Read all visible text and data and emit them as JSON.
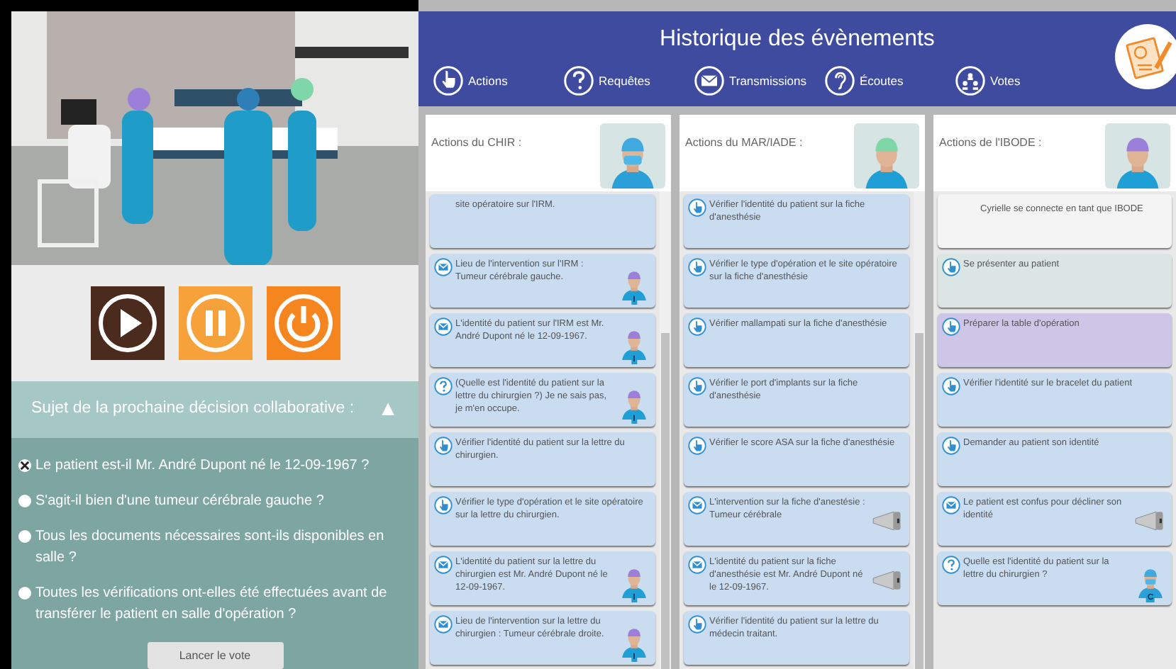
{
  "controls": [
    {
      "kind": "play"
    },
    {
      "kind": "pause"
    },
    {
      "kind": "power"
    }
  ],
  "decision": {
    "title": "Sujet de la prochaine décision collaborative :",
    "toggle": "▲",
    "questions": [
      {
        "text": "Le patient est-il Mr. André Dupont né le 12-09-1967 ?",
        "checked": true
      },
      {
        "text": "S'agit-il bien d'une tumeur cérébrale gauche ?",
        "checked": false
      },
      {
        "text": "Tous les documents nécessaires sont-ils disponibles en salle ?",
        "checked": false
      },
      {
        "text": "Toutes les vérifications ont-elles été effectuées avant de transférer le patient en salle d'opération ?",
        "checked": false
      }
    ],
    "button": "Lancer le vote"
  },
  "header": {
    "title": "Historique des évènements",
    "nav": [
      {
        "label": "Actions",
        "kind": "hand"
      },
      {
        "label": "Requêtes",
        "kind": "question"
      },
      {
        "label": "Transmissions",
        "kind": "mail"
      },
      {
        "label": "Écoutes",
        "kind": "ear"
      },
      {
        "label": "Votes",
        "kind": "people"
      }
    ]
  },
  "columns": [
    {
      "title": "Actions du CHIR :",
      "avatar": {
        "kind": "surgeon"
      },
      "scrollbar": true,
      "cards": [
        {
          "kind": "plain",
          "text": "site opératoire sur l'IRM.",
          "color": "#c9dcf0"
        },
        {
          "kind": "message",
          "text": "Lieu de l'intervention sur l'IRM : Tumeur cérébrale gauche.",
          "color": "#c9dcf0",
          "avatar": {
            "kind": "nurse",
            "badge": "I"
          }
        },
        {
          "kind": "message",
          "text": "L'identité du patient sur l'IRM est Mr. André Dupont né le 12-09-1967.",
          "color": "#c9dcf0",
          "avatar": {
            "kind": "nurse",
            "badge": "I"
          }
        },
        {
          "kind": "question",
          "text": "(Quelle est l'identité du patient sur la lettre du chirurgien ?) Je ne sais pas, je m'en occupe.",
          "color": "#c9dcf0",
          "avatar": {
            "kind": "nurse",
            "badge": "I"
          }
        },
        {
          "kind": "action",
          "text": "Vérifier l'identité du patient sur la lettre du chirurgien.",
          "color": "#c9dcf0"
        },
        {
          "kind": "action",
          "text": "Vérifier le type d'opération et le site opératoire sur la lettre du chirurgien.",
          "color": "#c9dcf0"
        },
        {
          "kind": "message",
          "text": "L'identité du patient sur la lettre du chirurgien est Mr. André Dupont né le 12-09-1967.",
          "color": "#c9dcf0",
          "avatar": {
            "kind": "nurse",
            "badge": "I"
          }
        },
        {
          "kind": "message",
          "text": "Lieu de l'intervention sur la lettre du chirurgien : Tumeur cérébrale droite.",
          "color": "#c9dcf0",
          "avatar": {
            "kind": "nurse",
            "badge": "I"
          }
        }
      ]
    },
    {
      "title": "Actions du MAR/IADE :",
      "avatar": {
        "kind": "anesthetist"
      },
      "scrollbar": true,
      "cards": [
        {
          "kind": "action",
          "text": "Vérifier l'identité du patient sur la fiche d'anesthésie",
          "color": "#c9dcf0"
        },
        {
          "kind": "action",
          "text": "Vérifier le type d'opération et le site opératoire sur la fiche d'anesthésie",
          "color": "#c9dcf0"
        },
        {
          "kind": "action",
          "text": "Vérifier mallampati sur la fiche d'anesthésie",
          "color": "#c9dcf0"
        },
        {
          "kind": "action",
          "text": "Vérifier le port d'implants sur la fiche d'anesthésie",
          "color": "#c9dcf0"
        },
        {
          "kind": "action",
          "text": "Vérifier le score ASA sur la fiche d'anesthésie",
          "color": "#c9dcf0"
        },
        {
          "kind": "message",
          "text": "L'intervention sur la fiche d'anestésie : Tumeur cérébrale",
          "color": "#c9dcf0",
          "avatar": {
            "kind": "speaker"
          }
        },
        {
          "kind": "message",
          "text": "L'identité du patient sur la fiche d'anesthésie est Mr. André Dupont né le 12-09-1967.",
          "color": "#c9dcf0",
          "avatar": {
            "kind": "speaker"
          }
        },
        {
          "kind": "action",
          "text": "Vérifier l'identité du patient sur la lettre du médecin traitant.",
          "color": "#c9dcf0"
        }
      ]
    },
    {
      "title": "Actions de l'IBODE :",
      "avatar": {
        "kind": "nurse"
      },
      "scrollbar": false,
      "cards": [
        {
          "kind": "plain",
          "text": "Cyrielle se connecte en tant que IBODE",
          "color": "#f4f4f4"
        },
        {
          "kind": "action",
          "text": "Se présenter au patient",
          "color": "#dbe6e4"
        },
        {
          "kind": "action",
          "text": "Préparer la table d'opération",
          "color": "#cdc6e6"
        },
        {
          "kind": "action",
          "text": "Vérifier l'identité sur le bracelet du patient",
          "color": "#c9dcf0"
        },
        {
          "kind": "action",
          "text": "Demander au patient son identité",
          "color": "#c9dcf0"
        },
        {
          "kind": "message",
          "text": "Le patient est confus pour décliner son identité",
          "color": "#c9dcf0",
          "avatar": {
            "kind": "speaker"
          }
        },
        {
          "kind": "question",
          "text": "Quelle est l'identité du patient sur la lettre du chirurgien ?",
          "color": "#c9dcf0",
          "avatar": {
            "kind": "surgeon",
            "badge": "C"
          }
        }
      ]
    }
  ]
}
